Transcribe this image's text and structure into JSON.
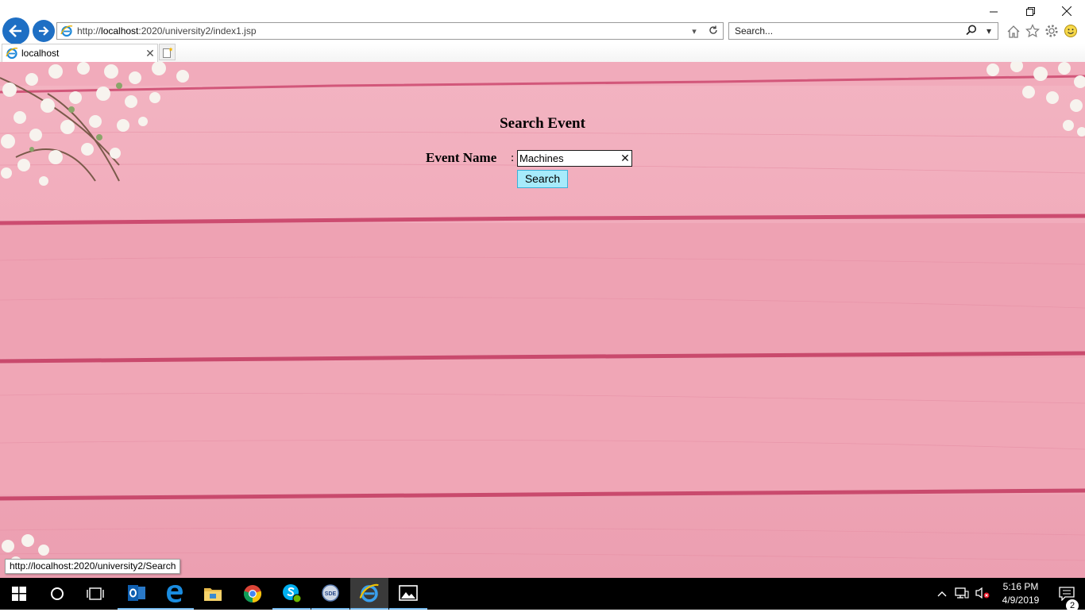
{
  "browser": {
    "address_url_prefix": "http://",
    "address_url_host": "localhost",
    "address_url_rest": ":2020/university2/index1.jsp",
    "search_placeholder": "Search...",
    "tab_title": "localhost"
  },
  "page": {
    "heading": "Search Event",
    "field_label": "Event Name",
    "colon": ":",
    "input_value": "Machines",
    "search_button": "Search"
  },
  "status_bar": {
    "text": "http://localhost:2020/university2/Search"
  },
  "taskbar": {
    "time": "5:16 PM",
    "date": "4/9/2019",
    "notification_count": "2",
    "apps": [
      "outlook-icon",
      "edge-icon",
      "file-explorer-icon",
      "chrome-icon",
      "skype-icon",
      "sde-icon",
      "internet-explorer-icon",
      "photos-icon"
    ]
  },
  "colors": {
    "page_background": "#f0a7b7",
    "search_button": "#a7ebfb",
    "nav_button": "#1e6fc4",
    "taskbar": "#000000"
  }
}
